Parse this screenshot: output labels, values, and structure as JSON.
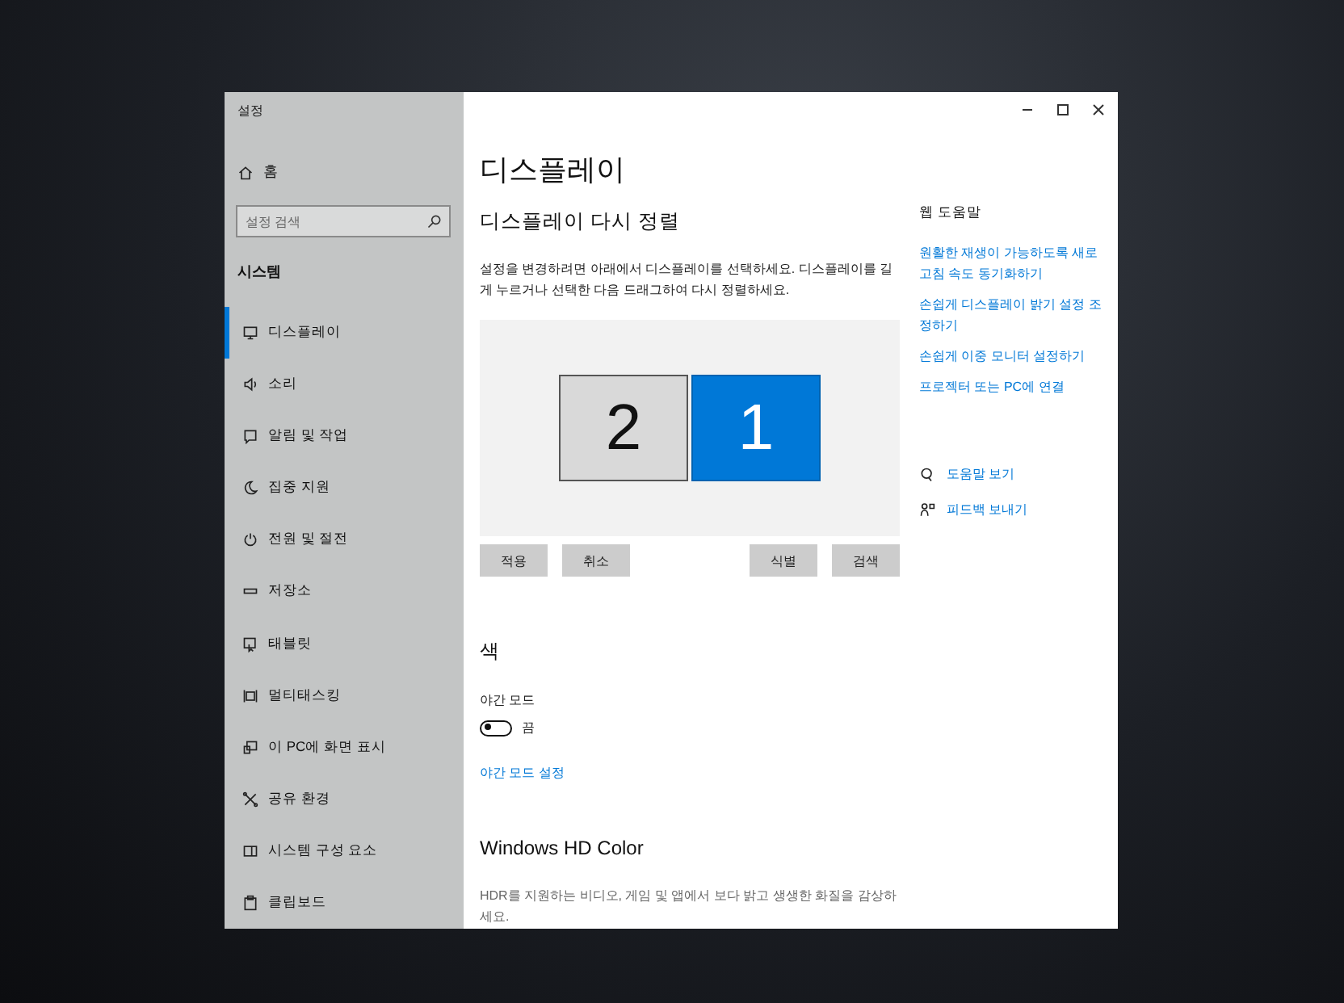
{
  "window": {
    "title": "설정"
  },
  "sidebar": {
    "home": "홈",
    "search": {
      "placeholder": "설정 검색"
    },
    "section": "시스템",
    "items": [
      {
        "label": "디스플레이",
        "selected": true
      },
      {
        "label": "소리",
        "selected": false
      },
      {
        "label": "알림 및 작업",
        "selected": false
      },
      {
        "label": "집중 지원",
        "selected": false
      },
      {
        "label": "전원 및 절전",
        "selected": false
      },
      {
        "label": "저장소",
        "selected": false
      },
      {
        "label": "태블릿",
        "selected": false
      },
      {
        "label": "멀티태스킹",
        "selected": false
      },
      {
        "label": "이 PC에 화면 표시",
        "selected": false
      },
      {
        "label": "공유 환경",
        "selected": false
      },
      {
        "label": "시스템 구성 요소",
        "selected": false
      },
      {
        "label": "클립보드",
        "selected": false
      }
    ]
  },
  "main": {
    "title": "디스플레이",
    "arrange": {
      "heading": "디스플레이 다시 정렬",
      "description": "설정을 변경하려면 아래에서 디스플레이를 선택하세요. 디스플레이를 길게 누르거나 선택한 다음 드래그하여 다시 정렬하세요.",
      "monitors": [
        {
          "label": "2",
          "selected": false
        },
        {
          "label": "1",
          "selected": true
        }
      ],
      "left_buttons": [
        {
          "label": "적용"
        },
        {
          "label": "취소"
        }
      ],
      "right_buttons": [
        {
          "label": "식별"
        },
        {
          "label": "검색"
        }
      ]
    },
    "color": {
      "heading": "색",
      "night_mode": {
        "label": "야간 모드",
        "on": false,
        "state_text": "끔"
      },
      "link": "야간 모드 설정"
    },
    "hd_color": {
      "heading": "Windows HD Color",
      "description": "HDR를 지원하는 비디오, 게임 및 앱에서 보다 밝고 생생한 화질을 감상하세요."
    }
  },
  "help": {
    "heading": "웹 도움말",
    "links": [
      "원활한 재생이 가능하도록 새로 고침 속도 동기화하기",
      "손쉽게 디스플레이 밝기 설정 조정하기",
      "손쉽게 이중 모니터 설정하기",
      "프로젝터 또는 PC에 연결"
    ],
    "actions": [
      {
        "label": "도움말 보기"
      },
      {
        "label": "피드백 보내기"
      }
    ]
  }
}
